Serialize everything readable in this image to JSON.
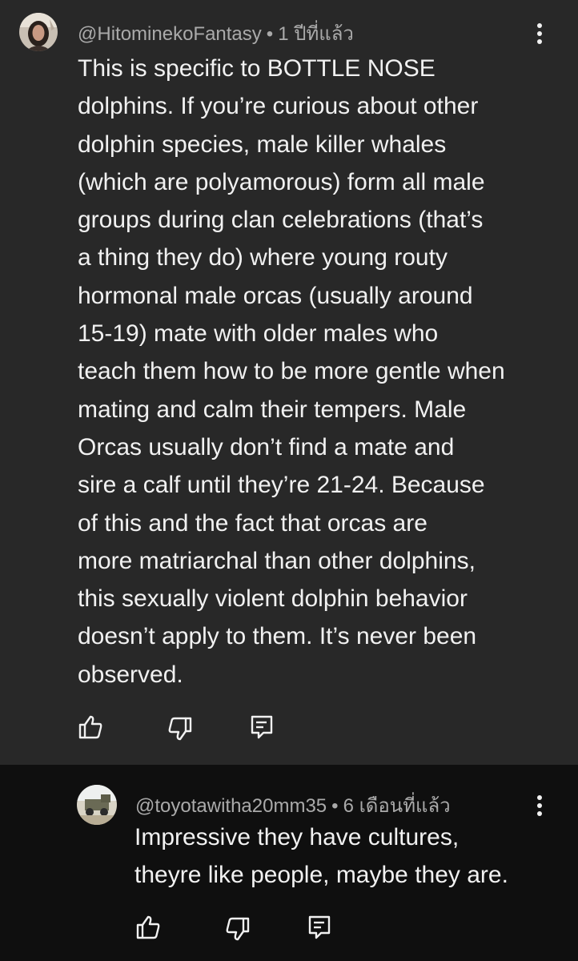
{
  "thread": {
    "comment": {
      "author": "@HitominekoFantasy",
      "separator": "•",
      "timestamp": "1 ปีที่แล้ว",
      "body_lines": [
        "This is specific to BOTTLE NOSE",
        "dolphins. If you’re curious about other",
        "dolphin species, male killer whales",
        "(which are polyamorous) form all male",
        "groups during clan celebrations (that’s",
        "a thing they do) where young routy",
        "hormonal male orcas (usually around",
        "15-19) mate with older males who",
        "teach them how to be more gentle when",
        "mating and calm their tempers. Male",
        "Orcas usually don’t find a mate and",
        "sire a calf until they’re 21-24. Because",
        "of this and the fact that orcas are",
        "more matriarchal than other dolphins,",
        "this sexually violent dolphin behavior",
        "doesn’t apply to them. It’s never been",
        "observed."
      ],
      "actions": [
        "like-icon",
        "dislike-icon",
        "reply-icon"
      ],
      "menu_icon": "more-vertical-icon"
    },
    "reply": {
      "author": "@toyotawitha20mm35",
      "separator": "•",
      "timestamp": "6 เดือนที่แล้ว",
      "body_lines": [
        "Impressive they have cultures,",
        "theyre like people, maybe they are."
      ],
      "actions": [
        "like-icon",
        "dislike-icon",
        "reply-icon"
      ],
      "menu_icon": "more-vertical-icon"
    }
  },
  "colors": {
    "comment_background": "#282828",
    "reply_background": "#0f0f0f",
    "text_primary": "#f1f1f1",
    "text_secondary": "#aaaaaa"
  }
}
